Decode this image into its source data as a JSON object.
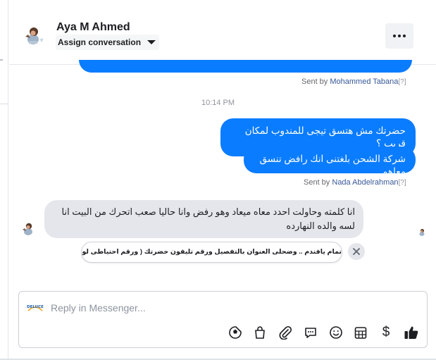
{
  "header": {
    "contact_name": "Aya M Ahmed",
    "assign_label": "Assign conversation"
  },
  "messages": {
    "sent_by_prefix": "Sent by",
    "sender_1": "Mohammed Tabana",
    "sender_1_mark": "[?]",
    "timestamp": "10:14 PM",
    "outgoing_1": "حضرتك مش هتسق تيجى للمندوب لمكان قريب ؟",
    "outgoing_2": "شركة الشحن بلغتنى انك رافض تنسق معاهم",
    "sender_2": "Nada Abdelrahman",
    "sender_2_mark": "[?]",
    "incoming_1": "انا كلمته وحاولت احدد معاه ميعاد وهو رفض وانا حاليا صعب اتحرك من البيت انا لسه والده النهارده"
  },
  "suggestion": {
    "text": "تمام يافندم .. وضحلى العنوان بالتفصيل ورقم تليفون حضرتك ( ورقم احتياطى لو موجود )"
  },
  "composer": {
    "placeholder": "Reply in Messenger...",
    "logo_text": "DELUCE",
    "currency_symbol": "$"
  },
  "colors": {
    "outgoing_bubble": "#0a7cff",
    "incoming_bubble": "#e4e6eb",
    "sender_link": "#385898"
  },
  "icons": [
    "more-icon",
    "caret-down-icon",
    "close-icon",
    "sticker-icon",
    "shopping-bag-icon",
    "attachment-icon",
    "saved-replies-icon",
    "emoji-icon",
    "appointment-icon",
    "payment-icon",
    "like-icon"
  ]
}
